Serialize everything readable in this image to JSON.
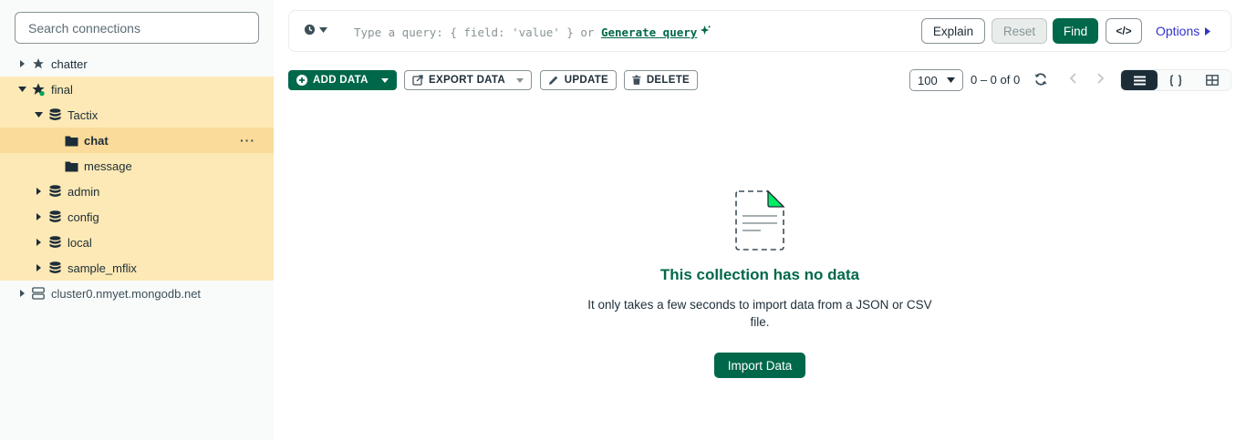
{
  "sidebar": {
    "search_placeholder": "Search connections",
    "tree": {
      "conn1": "chatter",
      "conn2": "final",
      "db_tactix": "Tactix",
      "coll_chat": "chat",
      "coll_message": "message",
      "db_admin": "admin",
      "db_config": "config",
      "db_local": "local",
      "db_sample": "sample_mflix",
      "conn3": "cluster0.nmyet.mongodb.net"
    },
    "more_glyph": "···"
  },
  "querybar": {
    "placeholder_prefix": "Type a query: { field: 'value' } or",
    "generate_link": "Generate query",
    "explain": "Explain",
    "reset": "Reset",
    "find": "Find",
    "code_glyph": "</>",
    "options": "Options"
  },
  "toolbar": {
    "add_data": "ADD DATA",
    "export_data": "EXPORT DATA",
    "update": "UPDATE",
    "delete": "DELETE",
    "page_size": "100",
    "range": "0 – 0 of 0"
  },
  "empty": {
    "title": "This collection has no data",
    "subtitle": "It only takes a few seconds to import data from a JSON or CSV file.",
    "import_button": "Import Data"
  },
  "colors": {
    "accent": "#00684a",
    "highlight": "#fde9b5",
    "selected": "#fbdb9a",
    "link": "#3333cc"
  }
}
